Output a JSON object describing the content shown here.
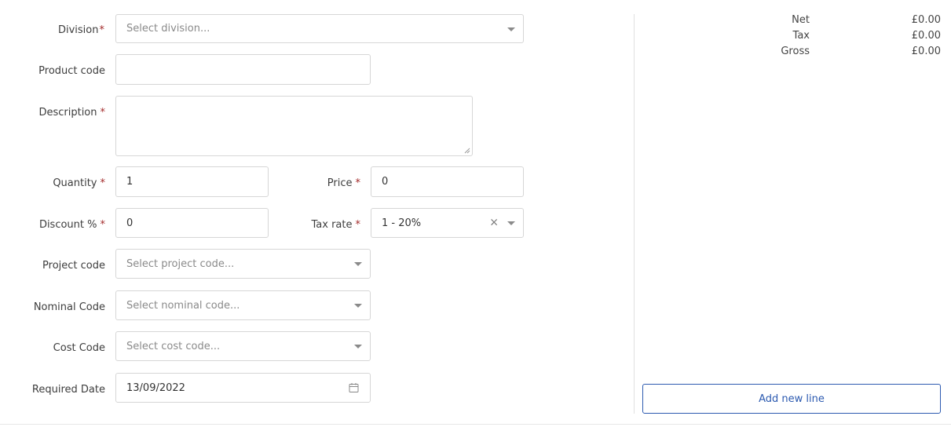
{
  "form": {
    "division": {
      "label": "Division",
      "required_mark": "*",
      "placeholder": "Select division..."
    },
    "product_code": {
      "label": "Product code",
      "value": ""
    },
    "description": {
      "label": "Description",
      "required_mark": "*",
      "value": ""
    },
    "quantity": {
      "label": "Quantity",
      "required_mark": "*",
      "value": "1"
    },
    "price": {
      "label": "Price",
      "required_mark": "*",
      "value": "0"
    },
    "discount": {
      "label": "Discount %",
      "required_mark": "*",
      "value": "0"
    },
    "tax_rate": {
      "label": "Tax rate",
      "required_mark": "*",
      "value": "1 - 20%",
      "clear_glyph": "×"
    },
    "project_code": {
      "label": "Project code",
      "placeholder": "Select project code..."
    },
    "nominal_code": {
      "label": "Nominal Code",
      "placeholder": "Select nominal code..."
    },
    "cost_code": {
      "label": "Cost Code",
      "placeholder": "Select cost code..."
    },
    "required_date": {
      "label": "Required Date",
      "value": "13/09/2022"
    }
  },
  "totals": [
    {
      "label": "Net",
      "value": "£0.00"
    },
    {
      "label": "Tax",
      "value": "£0.00"
    },
    {
      "label": "Gross",
      "value": "£0.00"
    }
  ],
  "actions": {
    "add_new_line": "Add new line"
  },
  "colors": {
    "required": "#a32a2a",
    "accent": "#2c5ab0",
    "border": "#d6d6d6"
  },
  "icons": {
    "dropdown": "chevron-down-icon",
    "clear": "clear-icon",
    "calendar": "calendar-icon"
  }
}
